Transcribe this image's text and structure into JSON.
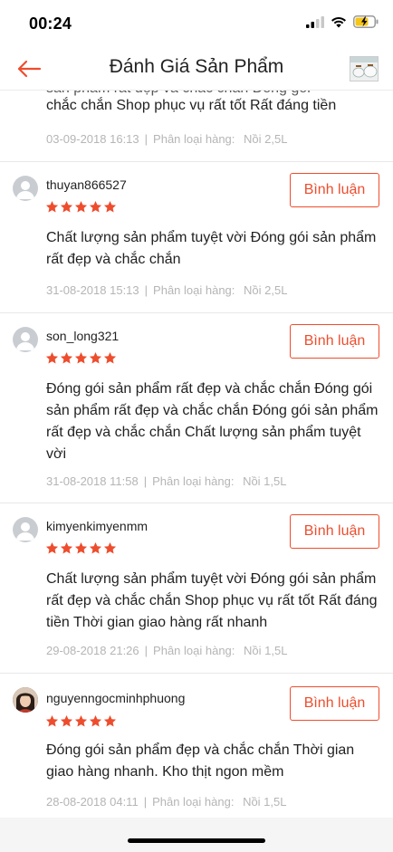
{
  "status": {
    "time": "00:24"
  },
  "nav": {
    "title": "Đánh Giá Sản Phẩm"
  },
  "reviews": [
    {
      "text": "chắc chắn Shop phục vụ rất tốt Rất đáng tiền",
      "date": "03-09-2018 16:13",
      "variant_label": "Phân loại hàng:",
      "variant": "Nồi 2,5L"
    },
    {
      "username": "thuyan866527",
      "rating": 5,
      "reply_label": "Bình luận",
      "text": "Chất lượng sản phẩm tuyệt vời Đóng gói sản phẩm rất đẹp và chắc chắn",
      "date": "31-08-2018 15:13",
      "variant_label": "Phân loại hàng:",
      "variant": "Nồi 2,5L"
    },
    {
      "username": "son_long321",
      "rating": 5,
      "reply_label": "Bình luận",
      "text": "Đóng gói sản phẩm rất đẹp và chắc chắn Đóng gói sản phẩm rất đẹp và chắc chắn Đóng gói sản phẩm rất đẹp và chắc chắn Chất lượng sản phẩm tuyệt vời",
      "date": "31-08-2018 11:58",
      "variant_label": "Phân loại hàng:",
      "variant": "Nồi 1,5L"
    },
    {
      "username": "kimyenkimyenmm",
      "rating": 5,
      "reply_label": "Bình luận",
      "text": "Chất lượng sản phẩm tuyệt vời Đóng gói sản phẩm rất đẹp và chắc chắn Shop phục vụ rất tốt Rất đáng tiền Thời gian giao hàng rất nhanh",
      "date": "29-08-2018 21:26",
      "variant_label": "Phân loại hàng:",
      "variant": "Nồi 1,5L"
    },
    {
      "username": "nguyenngocminhphuong",
      "rating": 5,
      "reply_label": "Bình luận",
      "text": "Đóng gói sản phẩm đẹp và chắc chắn Thời gian giao hàng nhanh. Kho thịt ngon mềm",
      "date": "28-08-2018 04:11",
      "variant_label": "Phân loại hàng:",
      "variant": "Nồi 1,5L"
    }
  ],
  "colors": {
    "accent": "#ee4d2d",
    "star": "#ee4d2d",
    "muted": "#b5b5b5"
  },
  "icons": {
    "back": "arrow-left-icon",
    "signal": "cellular-signal-icon",
    "wifi": "wifi-icon",
    "battery": "battery-charging-icon",
    "star": "star-icon"
  }
}
